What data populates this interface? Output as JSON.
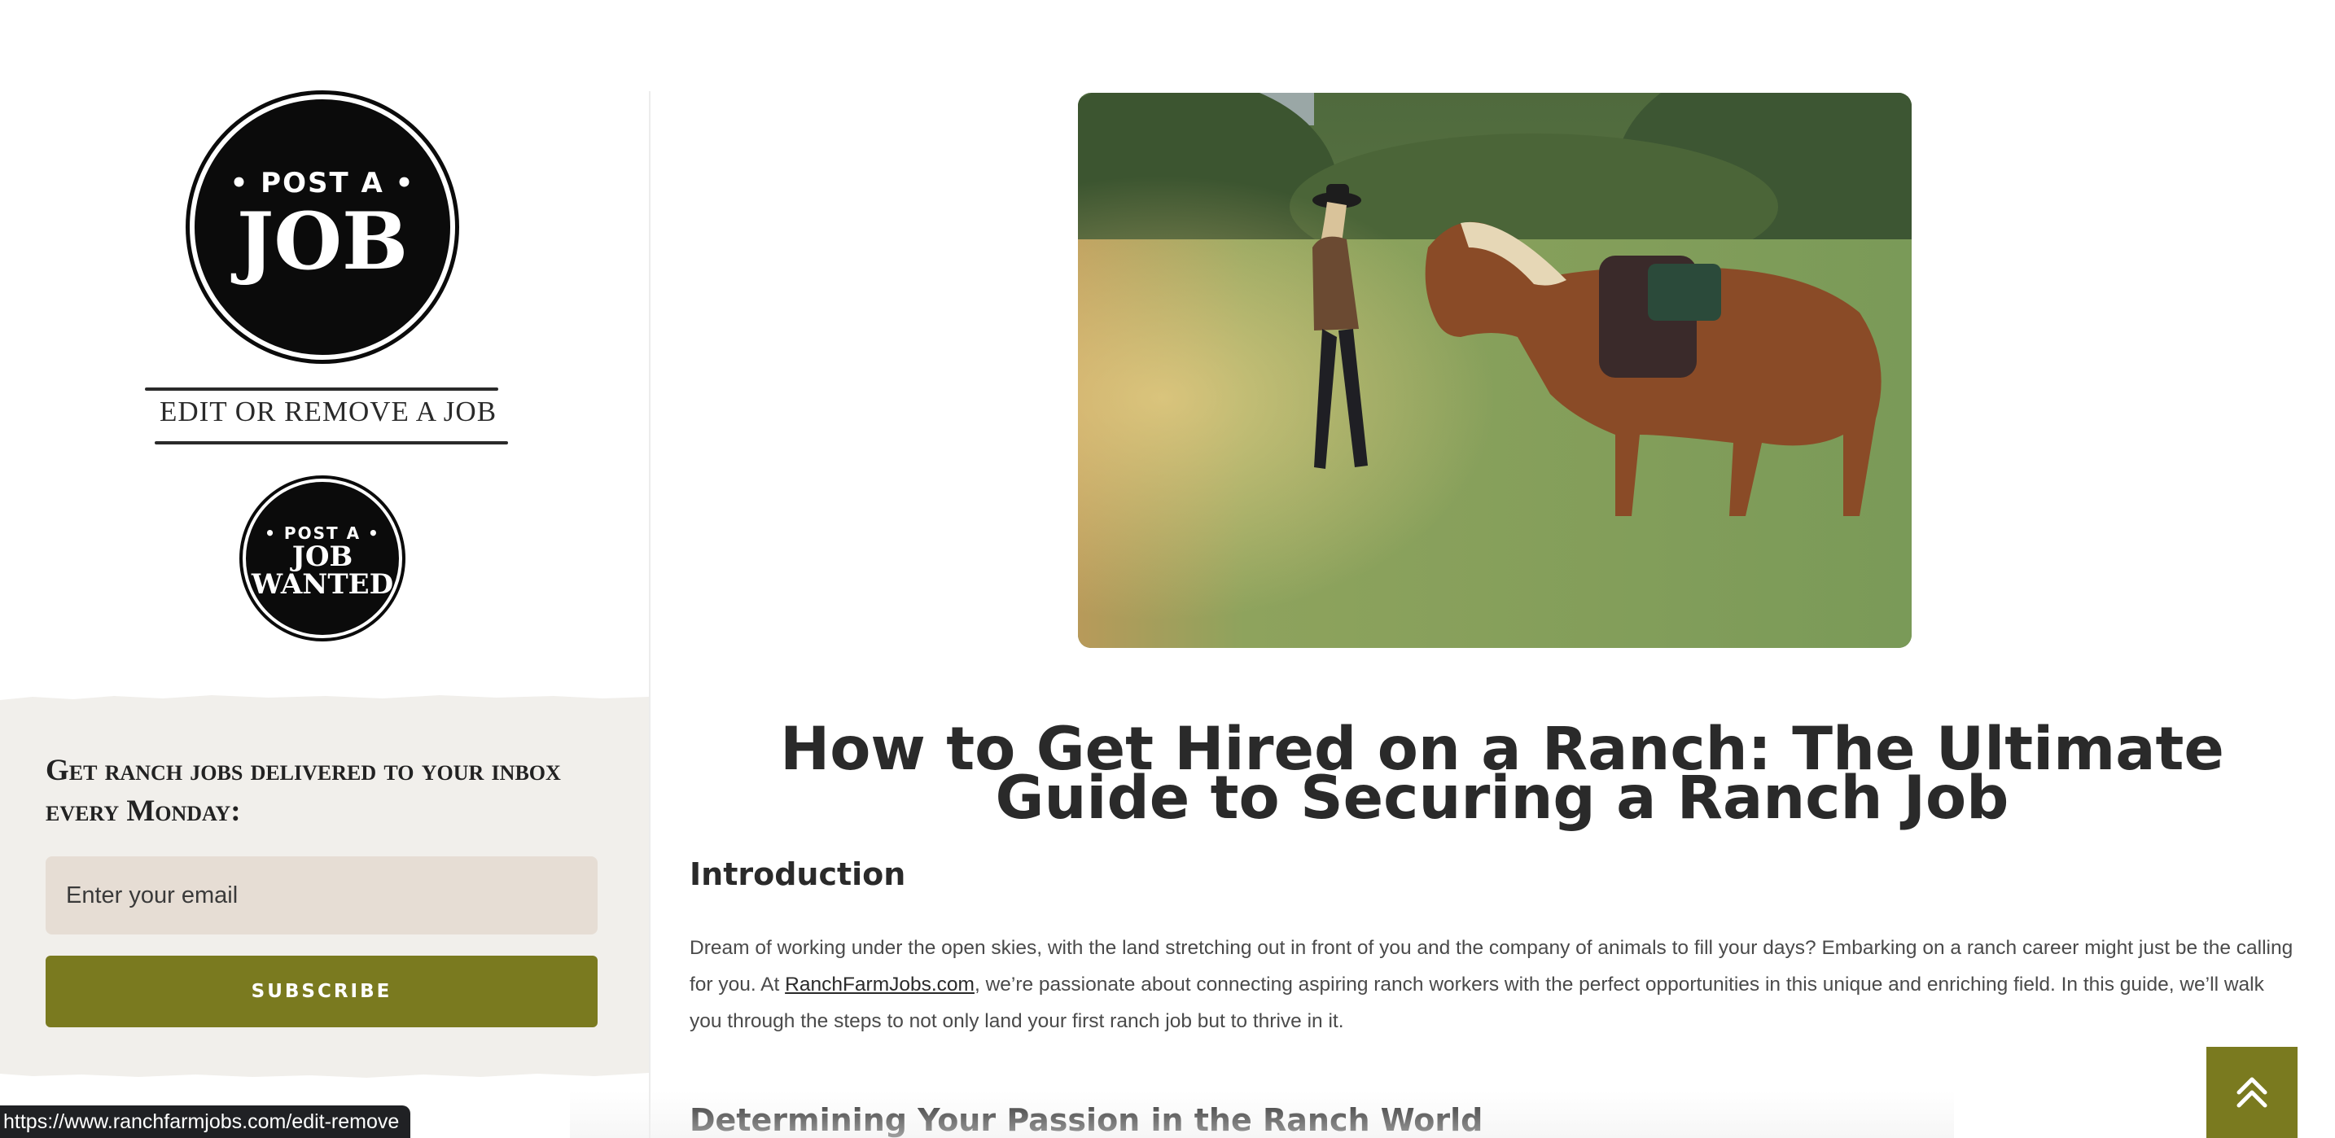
{
  "sidebar": {
    "post_job_badge": {
      "line1": "• POST A •",
      "line2": "JOB"
    },
    "edit_remove_link": "EDIT OR REMOVE A JOB",
    "post_wanted_badge": {
      "line1": "• POST A •",
      "line2": "JOB",
      "line3": "WANTED"
    },
    "newsletter": {
      "heading": "Get ranch jobs delivered to your inbox every Monday:",
      "email_placeholder": "Enter your email",
      "subscribe_label": "SUBSCRIBE"
    }
  },
  "article": {
    "title": "How to Get Hired on a Ranch: The Ultimate Guide to Securing a Ranch Job",
    "intro_heading": "Introduction",
    "intro_text_1": "Dream of working under the open skies, with the land stretching out in front of you and the company of animals to fill your days? Embarking on a ranch career might just be the calling for you. At ",
    "intro_link": "RanchFarmJobs.com",
    "intro_text_2": ", we’re passionate about connecting aspiring ranch workers with the perfect opportunities in this unique and enriching field. In this guide, we’ll walk you through the steps to not only land your first ranch job but to thrive in it.",
    "next_heading": "Determining Your Passion in the Ranch World"
  },
  "status_bar": {
    "url": "https://www.ranchfarmjobs.com/edit-remove"
  },
  "icons": {
    "scroll_top": "double-chevron-up-icon"
  },
  "colors": {
    "accent": "#7a7a1f",
    "newsletter_bg": "#f1efeb",
    "input_bg": "#e6ddd4"
  }
}
